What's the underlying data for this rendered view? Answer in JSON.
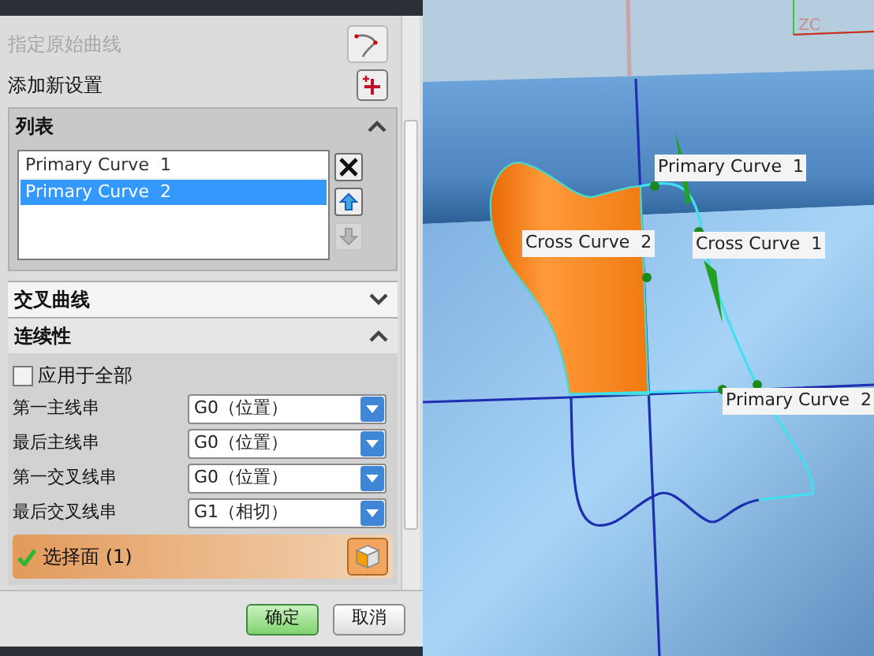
{
  "dialog": {
    "original_curve": {
      "label": "指定原始曲线",
      "disabled": true
    },
    "add_new_set": {
      "label": "添加新设置"
    },
    "list_group": {
      "title": "列表",
      "expanded": true,
      "items": [
        {
          "label": "Primary Curve  1",
          "selected": false
        },
        {
          "label": "Primary Curve  2",
          "selected": true
        }
      ],
      "actions": [
        {
          "kind": "delete",
          "disabled": false
        },
        {
          "kind": "up",
          "disabled": false
        },
        {
          "kind": "down",
          "disabled": true
        }
      ]
    },
    "cross_curves_group": {
      "title": "交叉曲线",
      "expanded": false
    },
    "continuity_group": {
      "title": "连续性",
      "expanded": true,
      "apply_to_all": {
        "label": "应用于全部",
        "checked": false
      },
      "fields": [
        {
          "label": "第一主线串",
          "value": "G0（位置）"
        },
        {
          "label": "最后主线串",
          "value": "G0（位置）"
        },
        {
          "label": "第一交叉线串",
          "value": "G0（位置）"
        },
        {
          "label": "最后交叉线串",
          "value": "G1（相切）"
        }
      ],
      "select_face": {
        "label": "选择面 (1)",
        "complete": true
      }
    },
    "buttons": [
      {
        "label": "确定",
        "kind": "primary"
      },
      {
        "label": "取消",
        "kind": "secondary"
      }
    ]
  },
  "viewport": {
    "axis_label": "ZC",
    "labels": [
      "Primary Curve  1",
      "Cross Curve  2",
      "Cross Curve  1",
      "Primary Curve  2"
    ]
  }
}
